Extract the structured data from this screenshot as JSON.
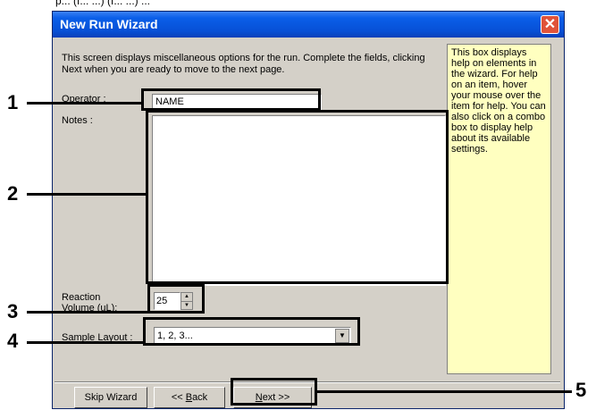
{
  "top_fragment": "p... (f... ...) (f... ...) ...",
  "window": {
    "title": "New Run Wizard",
    "close_glyph": "✕"
  },
  "intro": "This screen displays miscellaneous options for the run. Complete the fields, clicking Next when you are ready to move to the next page.",
  "operator": {
    "label_accel": "O",
    "label_rest": "perator :",
    "value": "NAME"
  },
  "notes": {
    "label": "Notes :",
    "value": ""
  },
  "reaction": {
    "label_line1": "Reaction",
    "label_line2": "Volume (uL):",
    "value": "25"
  },
  "sample_layout": {
    "label": "Sample Layout :",
    "value": "1, 2, 3..."
  },
  "help_text": "This box displays help on elements in the wizard. For help on an item, hover your mouse over the item for help. You can also click on a combo box to display help about its available settings.",
  "buttons": {
    "skip": "Skip Wizard",
    "back_prefix": "<< ",
    "back_accel": "B",
    "back_rest": "ack",
    "next_accel": "N",
    "next_rest": "ext >>"
  },
  "callouts": [
    "1",
    "2",
    "3",
    "4",
    "5"
  ],
  "colors": {
    "title_bar": "#0a5ee8",
    "close": "#e0533a",
    "dialog": "#d4d0c8",
    "help_bg": "#ffffc0"
  }
}
